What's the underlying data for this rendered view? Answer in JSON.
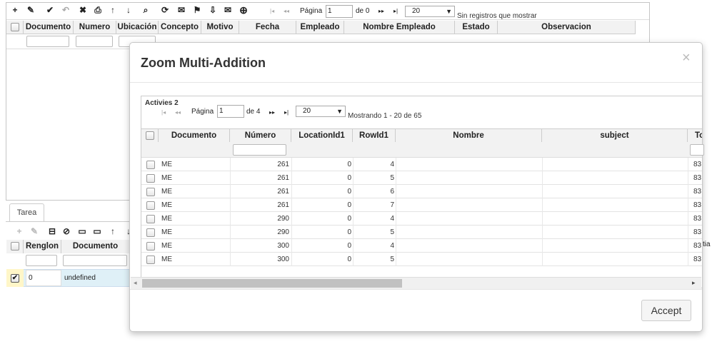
{
  "top_toolbar": {
    "icons": [
      "+",
      "✎",
      "✔",
      "↶",
      "✖",
      "⎙",
      "↑",
      "↓",
      "⌕",
      "⟳",
      "✉",
      "⚑",
      "⇩",
      "✉",
      "⊕"
    ],
    "pager": {
      "first": "|◂",
      "prev": "◂◂",
      "page_label": "Página",
      "page_value": "1",
      "of_label": "de 0",
      "next": "▸▸",
      "last": "▸|",
      "rows": "20",
      "status": "Sin registros que mostrar"
    }
  },
  "main_table": {
    "columns": [
      "Documento",
      "Numero",
      "Ubicación",
      "Concepto",
      "Motivo",
      "Fecha",
      "Empleado",
      "Nombre Empleado",
      "Estado",
      "Observacion"
    ]
  },
  "detail": {
    "tab": "Tarea",
    "toolbar_icons": [
      "+",
      "✎",
      "⊟",
      "⊘",
      "▭",
      "▭",
      "↑",
      "↓"
    ],
    "columns": [
      "Renglon",
      "Documento"
    ],
    "row": {
      "renglon": "0",
      "documento": "undefined"
    },
    "cut_text": "tia"
  },
  "dialog": {
    "title": "Zoom Multi-Addition",
    "close": "×",
    "section_title": "Activies 2",
    "pager": {
      "first": "|◂",
      "prev": "◂◂",
      "page_label": "Página",
      "page_value": "1",
      "of_label": "de 4",
      "next": "▸▸",
      "last": "▸|",
      "rows": "20",
      "status": "Mostrando 1 - 20 de 65"
    },
    "columns": [
      "Documento",
      "Número",
      "LocationId1",
      "RowId1",
      "Nombre",
      "subject",
      "To"
    ],
    "rows": [
      {
        "documento": "ME",
        "numero": "261",
        "location": "0",
        "rowid": "4",
        "nombre": "",
        "subject": "",
        "to": "83"
      },
      {
        "documento": "ME",
        "numero": "261",
        "location": "0",
        "rowid": "5",
        "nombre": "",
        "subject": "",
        "to": "83"
      },
      {
        "documento": "ME",
        "numero": "261",
        "location": "0",
        "rowid": "6",
        "nombre": "",
        "subject": "",
        "to": "83"
      },
      {
        "documento": "ME",
        "numero": "261",
        "location": "0",
        "rowid": "7",
        "nombre": "",
        "subject": "",
        "to": "83"
      },
      {
        "documento": "ME",
        "numero": "290",
        "location": "0",
        "rowid": "4",
        "nombre": "",
        "subject": "",
        "to": "83"
      },
      {
        "documento": "ME",
        "numero": "290",
        "location": "0",
        "rowid": "5",
        "nombre": "",
        "subject": "",
        "to": "83"
      },
      {
        "documento": "ME",
        "numero": "300",
        "location": "0",
        "rowid": "4",
        "nombre": "",
        "subject": "",
        "to": "83"
      },
      {
        "documento": "ME",
        "numero": "300",
        "location": "0",
        "rowid": "5",
        "nombre": "",
        "subject": "",
        "to": "83"
      }
    ],
    "scroll_left": "◂",
    "scroll_right": "▸",
    "accept": "Accept"
  },
  "colors": {
    "overlay_border": "#c8c8c8",
    "header_bg": "#f2f2f2",
    "selected_row": "#dff0f7",
    "accent_cell": "#fff6c8"
  }
}
